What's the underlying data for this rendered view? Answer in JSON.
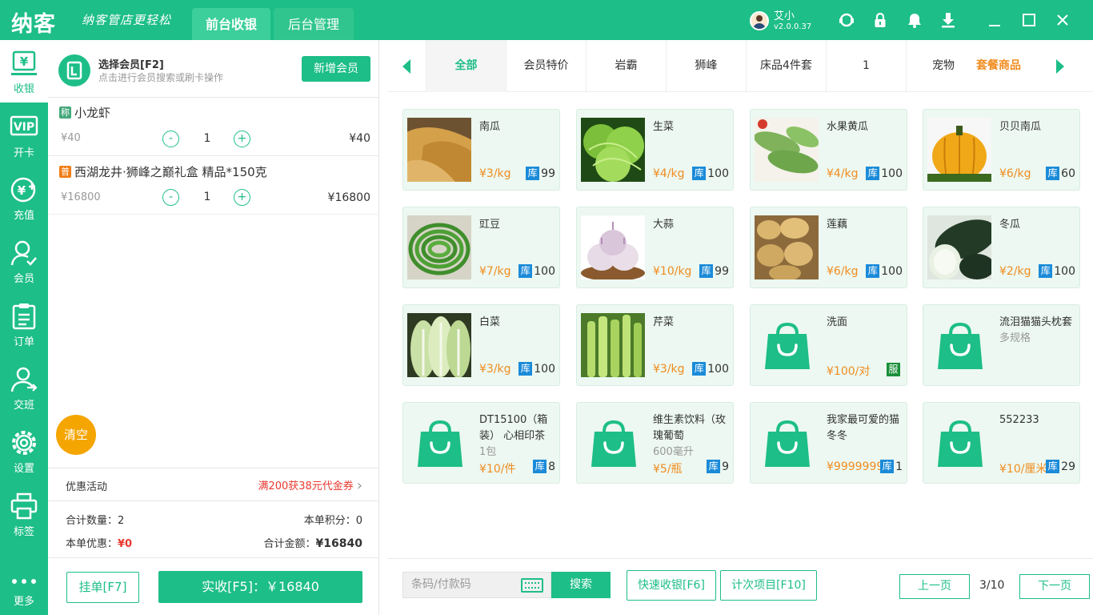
{
  "app": {
    "logo": "纳客",
    "slogan": "纳客管店更轻松",
    "top_tabs": [
      "前台收银",
      "后台管理"
    ],
    "user_name": "艾小",
    "version": "v2.0.0.37"
  },
  "sidebar": {
    "items": [
      "收银",
      "开卡",
      "充值",
      "会员",
      "订单",
      "交班",
      "设置",
      "标签",
      "更多"
    ],
    "vip_text": "VIP"
  },
  "member": {
    "title": "选择会员[F2]",
    "subtitle": "点击进行会员搜索或刷卡操作",
    "add_button": "新增会员"
  },
  "cart": {
    "items": [
      {
        "tag": "称",
        "name": "小龙虾",
        "unit_price": "¥40",
        "qty": "1",
        "total": "¥40"
      },
      {
        "tag": "普",
        "name": "西湖龙井·狮峰之巅礼盒 精品*150克",
        "unit_price": "¥16800",
        "qty": "1",
        "total": "¥16800"
      }
    ],
    "minus": "-",
    "plus": "+",
    "clear_button": "清空"
  },
  "summary": {
    "promo_label": "优惠活动",
    "promo_value": "满200获38元代金券",
    "count_label": "合计数量：",
    "count_value": "2",
    "points_label": "本单积分：",
    "points_value": "0",
    "discount_label": "本单优惠：",
    "discount_value": "¥0",
    "amount_label": "合计金额：",
    "amount_value": "¥16840"
  },
  "actions": {
    "hang_button": "挂单[F7]",
    "pay_button": "实收[F5]：￥16840"
  },
  "categories": {
    "items": [
      "全部",
      "会员特价",
      "岩霸",
      "狮峰",
      "床品4件套",
      "1",
      "宠物"
    ],
    "combo": "套餐商品",
    "active": "全部"
  },
  "products": [
    {
      "name": "南瓜",
      "price": "¥3/kg",
      "stock_tag": "库",
      "stock": "99",
      "image": "pumpkin"
    },
    {
      "name": "生菜",
      "price": "¥4/kg",
      "stock_tag": "库",
      "stock": "100",
      "image": "lettuce"
    },
    {
      "name": "水果黄瓜",
      "price": "¥4/kg",
      "stock_tag": "库",
      "stock": "100",
      "image": "cucumber"
    },
    {
      "name": "贝贝南瓜",
      "price": "¥6/kg",
      "stock_tag": "库",
      "stock": "60",
      "image": "baby-pumpkin"
    },
    {
      "name": "豇豆",
      "price": "¥7/kg",
      "stock_tag": "库",
      "stock": "100",
      "image": "beans"
    },
    {
      "name": "大蒜",
      "price": "¥10/kg",
      "stock_tag": "库",
      "stock": "99",
      "image": "garlic"
    },
    {
      "name": "莲藕",
      "price": "¥6/kg",
      "stock_tag": "库",
      "stock": "100",
      "image": "potato"
    },
    {
      "name": "冬瓜",
      "price": "¥2/kg",
      "stock_tag": "库",
      "stock": "100",
      "image": "wax-gourd"
    },
    {
      "name": "白菜",
      "price": "¥3/kg",
      "stock_tag": "库",
      "stock": "100",
      "image": "cabbage"
    },
    {
      "name": "芹菜",
      "price": "¥3/kg",
      "stock_tag": "库",
      "stock": "100",
      "image": "celery"
    },
    {
      "name": "洗面",
      "price": "¥100/对",
      "service_tag": "服",
      "image": "bag"
    },
    {
      "name": "流泪猫猫头枕套",
      "spec": "多规格",
      "image": "bag"
    },
    {
      "name": "DT15100（箱装） 心相印茶",
      "spec": "1包",
      "price": "¥10/件",
      "stock_tag": "库",
      "stock": "8",
      "image": "bag"
    },
    {
      "name": "维生素饮料（玫瑰葡萄",
      "spec": "600毫升",
      "price": "¥5/瓶",
      "stock_tag": "库",
      "stock": "9",
      "image": "bag"
    },
    {
      "name": "我家最可爱的猫冬冬",
      "price": "¥9999999",
      "stock_tag": "库",
      "stock": "1",
      "image": "bag"
    },
    {
      "name": "552233",
      "price": "¥10/厘米",
      "stock_tag": "库",
      "stock": "29",
      "image": "bag"
    }
  ],
  "bottom": {
    "barcode_placeholder": "条码/付款码",
    "search_button": "搜索",
    "quick_button": "快速收银[F6]",
    "count_button": "计次项目[F10]",
    "prev_button": "上一页",
    "page": "3/10",
    "next_button": "下一页"
  },
  "colors": {
    "accent": "#1dbe87",
    "price": "#f08c1f",
    "danger": "#e8392f",
    "stock": "#1b8bd9",
    "clear": "#f5a500"
  }
}
